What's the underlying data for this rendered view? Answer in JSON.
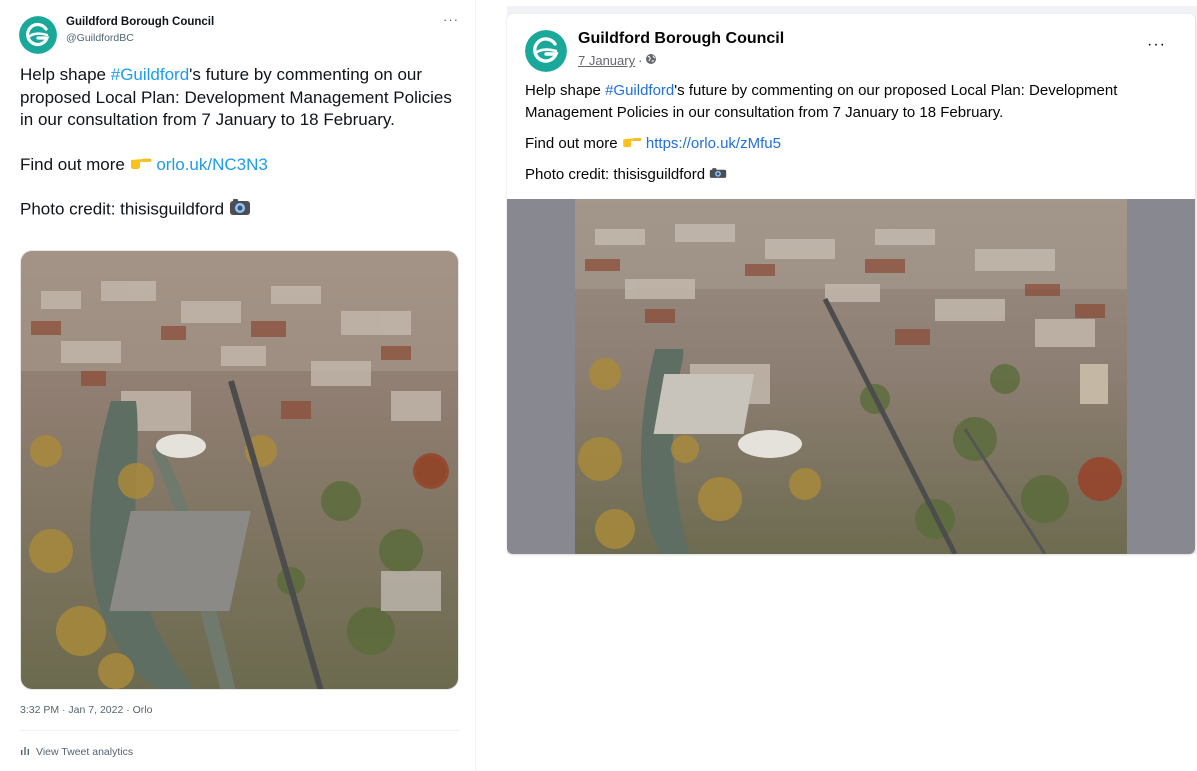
{
  "twitter": {
    "account_name": "Guildford Borough Council",
    "handle": "@GuildfordBC",
    "more": "···",
    "text_before_hashtag": "Help shape ",
    "hashtag": "#Guildford",
    "text_after_hashtag": "'s future by commenting on our proposed Local Plan: Development Management Policies in our consultation from 7 January to 18 February.",
    "find_out_more": "Find out more ",
    "link": "orlo.uk/NC3N3",
    "photo_credit": "Photo credit: thisisguildford ",
    "timestamp": "3:32 PM · Jan 7, 2022 · Orlo",
    "analytics": "View Tweet analytics"
  },
  "facebook": {
    "page_name": "Guildford Borough Council",
    "date": "7 January",
    "date_separator": " · ",
    "more": "···",
    "text_before_hashtag": "Help shape ",
    "hashtag": "#Guildford",
    "text_after_hashtag": "'s future by commenting on our proposed Local Plan: Development Management Policies in our consultation from 7 January to 18 February.",
    "find_out_more": "Find out more ",
    "link": "https://orlo.uk/zMfu5",
    "photo_credit": "Photo credit: thisisguildford "
  },
  "colors": {
    "brand_teal": "#1aa89a",
    "twitter_link": "#1d9bf0",
    "facebook_link": "#216fdb"
  }
}
